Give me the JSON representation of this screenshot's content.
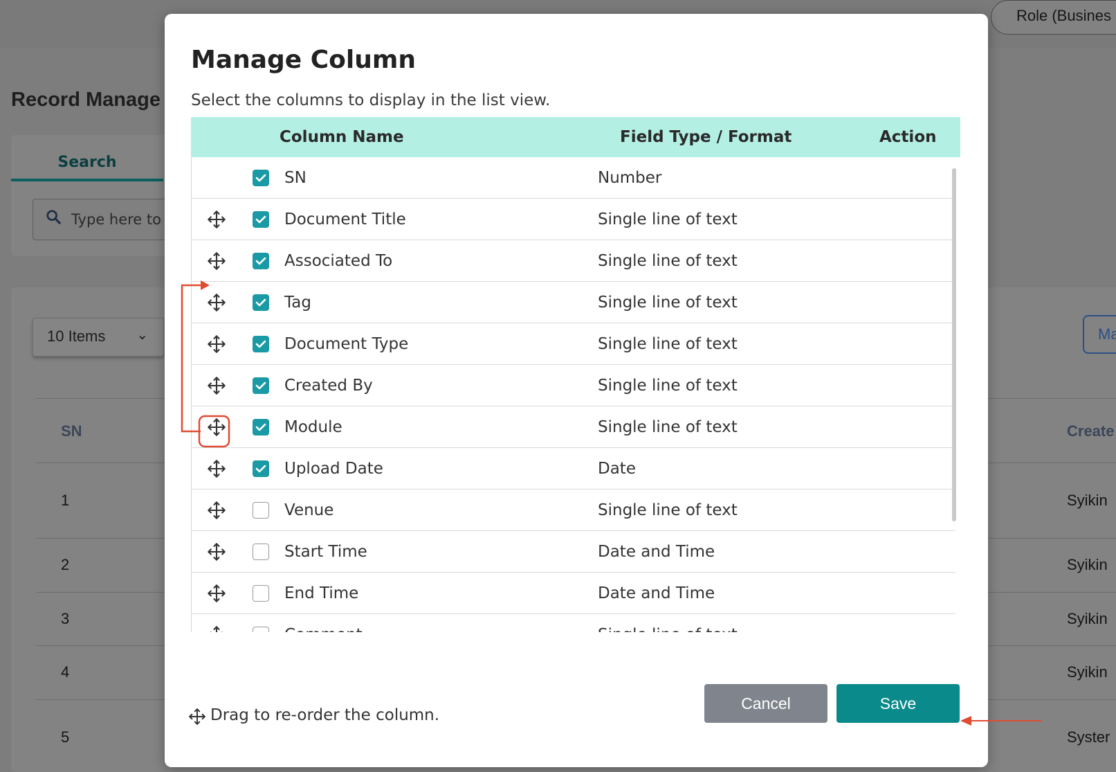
{
  "background": {
    "role_pill": "Role (Busines",
    "page_title": "Record Manage",
    "tab_search": "Search",
    "search_placeholder": "Type here to",
    "items_select": "10 Items",
    "manage_button": "Ma",
    "table": {
      "headers": [
        "SN",
        "Create"
      ],
      "rows": [
        {
          "sn": "1",
          "created": "Syikin"
        },
        {
          "sn": "2",
          "created": "Syikin"
        },
        {
          "sn": "3",
          "created": "Syikin"
        },
        {
          "sn": "4",
          "created": "Syikin"
        },
        {
          "sn": "5",
          "created": "Syster"
        }
      ]
    }
  },
  "modal": {
    "title": "Manage Column",
    "subtitle": "Select the columns to display in the list view.",
    "headers": {
      "column_name": "Column Name",
      "field_type": "Field Type / Format",
      "action": "Action"
    },
    "rows": [
      {
        "name": "SN",
        "type": "Number",
        "checked": true,
        "draggable": false
      },
      {
        "name": "Document Title",
        "type": "Single line of text",
        "checked": true,
        "draggable": true
      },
      {
        "name": "Associated To",
        "type": "Single line of text",
        "checked": true,
        "draggable": true
      },
      {
        "name": "Tag",
        "type": "Single line of text",
        "checked": true,
        "draggable": true
      },
      {
        "name": "Document Type",
        "type": "Single line of text",
        "checked": true,
        "draggable": true
      },
      {
        "name": "Created By",
        "type": "Single line of text",
        "checked": true,
        "draggable": true
      },
      {
        "name": "Module",
        "type": "Single line of text",
        "checked": true,
        "draggable": true
      },
      {
        "name": "Upload Date",
        "type": "Date",
        "checked": true,
        "draggable": true
      },
      {
        "name": "Venue",
        "type": "Single line of text",
        "checked": false,
        "draggable": true
      },
      {
        "name": "Start Time",
        "type": "Date and Time",
        "checked": false,
        "draggable": true
      },
      {
        "name": "End Time",
        "type": "Date and Time",
        "checked": false,
        "draggable": true
      },
      {
        "name": "Comment",
        "type": "Single line of text",
        "checked": false,
        "draggable": true
      }
    ],
    "hint": "Drag to re-order the column.",
    "cancel_label": "Cancel",
    "save_label": "Save"
  },
  "colors": {
    "header_bg": "#b4efe4",
    "checkbox": "#1a9aa5",
    "save": "#0a8a8a",
    "cancel": "#80858d",
    "annotation": "#e04b32"
  }
}
